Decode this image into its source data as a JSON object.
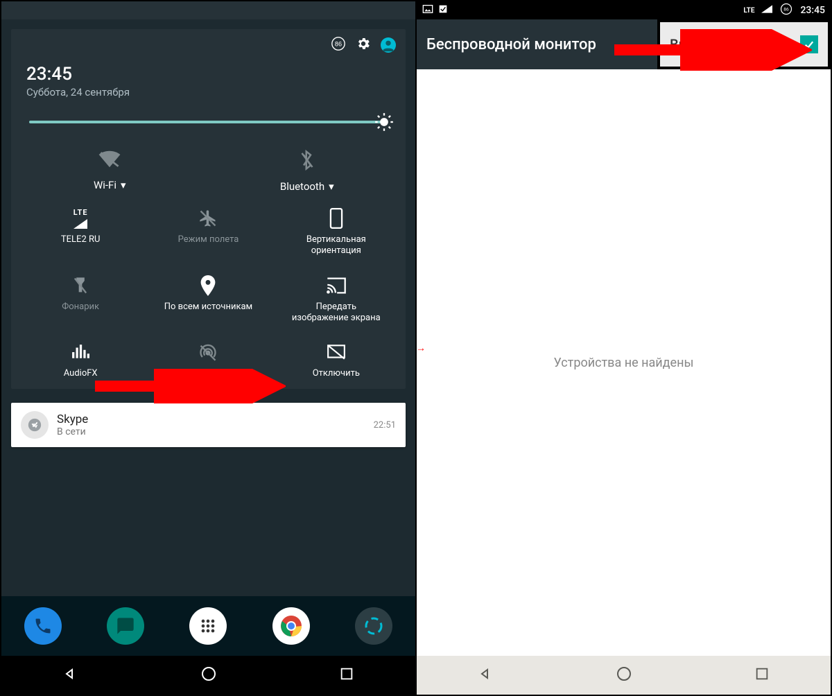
{
  "left": {
    "statusbar": {
      "time": ""
    },
    "qs": {
      "time": "23:45",
      "date": "Суббота, 24 сентября",
      "battery_badge": "86",
      "wifi_label": "Wi-Fi",
      "bluetooth_label": "Bluetooth",
      "tiles": {
        "cellular": {
          "lte": "LTE",
          "label": "TELE2 RU"
        },
        "airplane": "Режим полета",
        "rotation_line1": "Вертикальная",
        "rotation_line2": "ориентация",
        "flashlight": "Фонарик",
        "location": "По всем источникам",
        "cast_line1": "Передать",
        "cast_line2": "изображение экрана",
        "audiofx": "AudioFX",
        "hotspot": "Точка доступа",
        "disable": "Отключить"
      }
    },
    "notification": {
      "title": "Skype",
      "sub": "В сети",
      "time": "22:51"
    }
  },
  "right": {
    "statusbar": {
      "lte": "LTE",
      "battery": "86",
      "time": "23:45"
    },
    "appbar_title": "Беспроводной монитор",
    "enable_label": "Включить",
    "body_message": "Устройства не найдены"
  }
}
